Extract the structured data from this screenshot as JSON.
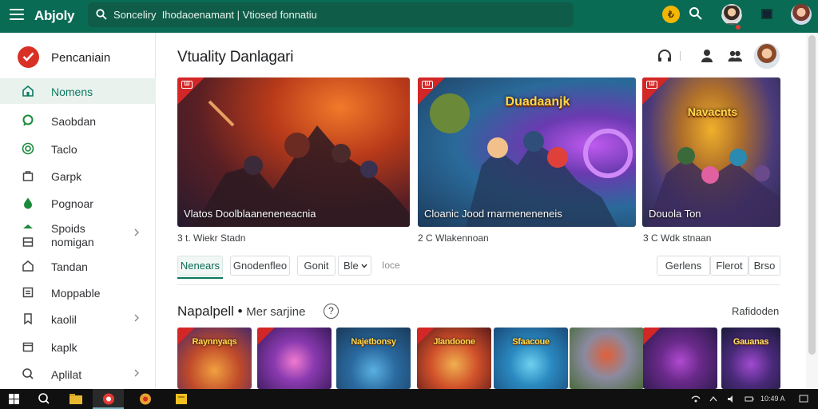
{
  "topbar": {
    "app_title": "Abjoly",
    "search_value": "Sonceliry  Ihodaoenamant | Vtiosed fonnatiu",
    "coin_label": "₺",
    "colors": {
      "bar": "#0a6b55",
      "search": "#0f5c48",
      "coin": "#f2b705"
    }
  },
  "sidebar": {
    "brand_label": "Pencaniain",
    "items": [
      {
        "label": "Nomens",
        "icon": "home-icon",
        "active": true
      },
      {
        "label": "Saobdan",
        "icon": "chat-icon"
      },
      {
        "label": "Taclo",
        "icon": "target-icon"
      },
      {
        "label": "Garpk",
        "icon": "bag-icon"
      },
      {
        "label": "Pognoar",
        "icon": "drop-icon"
      },
      {
        "label": "Spoids nomigan",
        "icon": "stack-icon",
        "chevron": true
      },
      {
        "label": "Tandan",
        "icon": "house-icon"
      },
      {
        "label": "Moppable",
        "icon": "list-icon"
      },
      {
        "label": "kaolil",
        "icon": "bookmark-icon",
        "chevron": true
      },
      {
        "label": "kaplk",
        "icon": "calendar-icon"
      },
      {
        "label": "Aplilat",
        "icon": "search-icon",
        "chevron": true
      }
    ]
  },
  "main": {
    "title": "Vtuality Danlagari",
    "featured": [
      {
        "title": "Vlatos Doolblaaneneneacnia",
        "subtitle": "3 t. Wiekr Stadn",
        "badge": "Ш"
      },
      {
        "title": "Cloanic Jood rnarmeneneneis",
        "subtitle": "2 C  Wlakennoan",
        "badge": "Ш"
      },
      {
        "title": "Douola Ton",
        "subtitle": "3 C  Wdk stnaan",
        "badge": "Ш"
      }
    ],
    "featured_logos": [
      "",
      "Duadaanjk",
      "Navacnts"
    ],
    "filter_chips": [
      "Nenears",
      "Gnodenfleo",
      "Gonit",
      "Ble"
    ],
    "filter_plain": "Ioce",
    "right_chips": [
      "Gerlens",
      "Flerot",
      "Brso"
    ],
    "section": {
      "title": "Napalpell •",
      "subtitle": "Mer sarjine",
      "help": "?",
      "see_all": "Rafidoden"
    },
    "thumbs": [
      "Raynnyaqs",
      "",
      "Najetbonsy",
      "Jlandoone",
      "Sfaacoue",
      "",
      "",
      "Gauanas"
    ]
  },
  "taskbar": {
    "tray_text": "10:49 A"
  }
}
